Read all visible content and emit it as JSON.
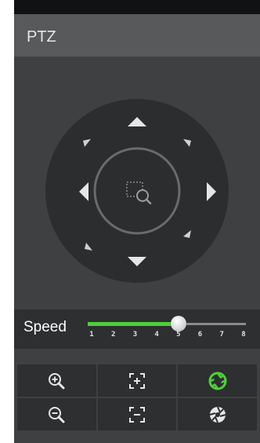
{
  "header": {
    "title": "PTZ"
  },
  "joystick": {
    "icons": {
      "up": "arrow-up-icon",
      "down": "arrow-down-icon",
      "left": "arrow-left-icon",
      "right": "arrow-right-icon",
      "up_left": "arrow-up-left-icon",
      "up_right": "arrow-up-right-icon",
      "down_left": "arrow-down-left-icon",
      "down_right": "arrow-down-right-icon",
      "center": "area-zoom-icon"
    }
  },
  "speed": {
    "label": "Speed",
    "ticks": [
      "1",
      "2",
      "3",
      "4",
      "5",
      "6",
      "7",
      "8"
    ],
    "current": 5,
    "min": 1,
    "max": 8
  },
  "controls": [
    {
      "id": "zoom-in",
      "icon": "zoom-in-icon"
    },
    {
      "id": "focus-near",
      "icon": "focus-near-icon"
    },
    {
      "id": "iris-open",
      "icon": "iris-open-icon"
    },
    {
      "id": "zoom-out",
      "icon": "zoom-out-icon"
    },
    {
      "id": "focus-far",
      "icon": "focus-far-icon"
    },
    {
      "id": "iris-close",
      "icon": "iris-close-icon"
    }
  ],
  "colors": {
    "accent": "#4cd137",
    "panel": "#3f4041",
    "header": "#57595b",
    "control_bg": "#2e2f30"
  }
}
